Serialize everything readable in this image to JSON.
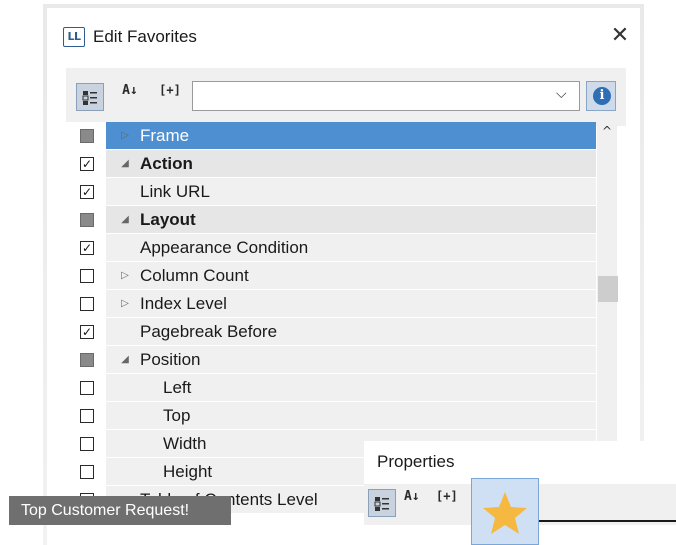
{
  "dialog": {
    "title": "Edit Favorites",
    "logo_text": "LL",
    "close_glyph": "✕"
  },
  "toolbar": {
    "categorized_icon": "categorized-view-icon",
    "sort_label": "A↓",
    "expand_label": "[+]",
    "search_value": "",
    "dropdown_glyph": "⌵",
    "info_glyph": "i"
  },
  "tree": {
    "rows": [
      {
        "label": "Frame",
        "check": "indeterminate",
        "expander": "collapsed",
        "category": false,
        "selected": true,
        "level": 0
      },
      {
        "label": "Action",
        "check": "checked",
        "expander": "expanded",
        "category": true,
        "selected": false,
        "level": 0
      },
      {
        "label": "Link URL",
        "check": "checked",
        "expander": "none",
        "category": false,
        "selected": false,
        "level": 0
      },
      {
        "label": "Layout",
        "check": "indeterminate",
        "expander": "expanded",
        "category": true,
        "selected": false,
        "level": 0
      },
      {
        "label": "Appearance Condition",
        "check": "checked",
        "expander": "none",
        "category": false,
        "selected": false,
        "level": 0
      },
      {
        "label": "Column Count",
        "check": "unchecked",
        "expander": "collapsed",
        "category": false,
        "selected": false,
        "level": 0
      },
      {
        "label": "Index Level",
        "check": "unchecked",
        "expander": "collapsed",
        "category": false,
        "selected": false,
        "level": 0
      },
      {
        "label": "Pagebreak Before",
        "check": "checked",
        "expander": "none",
        "category": false,
        "selected": false,
        "level": 0
      },
      {
        "label": "Position",
        "check": "indeterminate",
        "expander": "expanded",
        "category": false,
        "selected": false,
        "level": 0
      },
      {
        "label": "Left",
        "check": "unchecked",
        "expander": "none",
        "category": false,
        "selected": false,
        "level": 1
      },
      {
        "label": "Top",
        "check": "unchecked",
        "expander": "none",
        "category": false,
        "selected": false,
        "level": 1
      },
      {
        "label": "Width",
        "check": "unchecked",
        "expander": "none",
        "category": false,
        "selected": false,
        "level": 1
      },
      {
        "label": "Height",
        "check": "unchecked",
        "expander": "none",
        "category": false,
        "selected": false,
        "level": 1
      },
      {
        "label": "Table of Contents Level",
        "check": "unchecked",
        "expander": "none",
        "category": false,
        "selected": false,
        "level": 0
      }
    ],
    "scroll_up_glyph": "^"
  },
  "properties_panel": {
    "title": "Properties",
    "sort_label": "A↓",
    "expand_label": "[+]",
    "favorites_icon": "star-icon"
  },
  "badge": {
    "text": "Top Customer Request!"
  },
  "colors": {
    "selection": "#4d8fd0",
    "info": "#2f6db5",
    "star": "#f5b840",
    "badge_bg": "#6f6f6f"
  }
}
